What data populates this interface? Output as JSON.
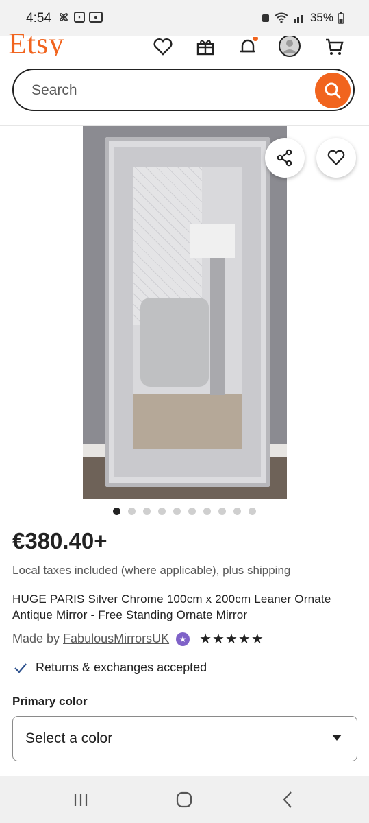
{
  "status_bar": {
    "time": "4:54",
    "battery": "35%"
  },
  "header": {
    "logo": "Etsy",
    "search_placeholder": "Search"
  },
  "product": {
    "image_count": 10,
    "active_image": 1,
    "price": "€380.40+",
    "taxes_text": "Local taxes included (where applicable), ",
    "shipping_link": "plus shipping",
    "title": "HUGE PARIS Silver Chrome 100cm x 200cm Leaner Ornate Antique Mirror - Free Standing Ornate Mirror",
    "made_by_prefix": "Made by ",
    "shop_name": "FabulousMirrorsUK",
    "rating_stars": 5,
    "stars_text": "★★★★★",
    "returns_text": "Returns & exchanges accepted"
  },
  "options": {
    "primary_color_label": "Primary color",
    "primary_color_value": "Select a color"
  },
  "colors": {
    "brand": "#f1641e",
    "star_seller": "#7f62c8"
  },
  "icons": [
    "favorites-icon",
    "gift-icon",
    "notifications-icon",
    "account-icon",
    "cart-icon",
    "search-icon",
    "share-icon",
    "heart-icon",
    "checkmark-icon",
    "recents-icon",
    "home-icon",
    "back-icon"
  ]
}
